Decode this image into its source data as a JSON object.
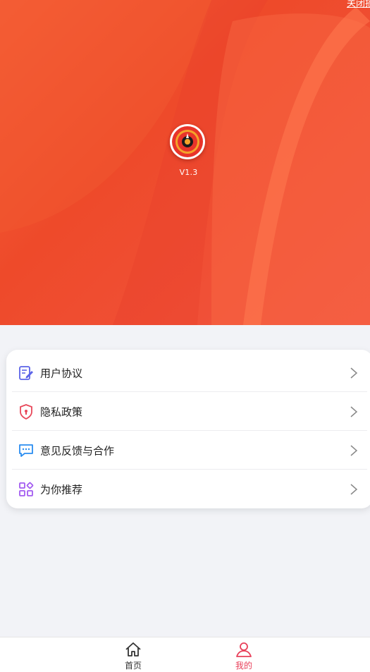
{
  "header": {
    "top_link": "关闭摇",
    "version": "V1.3",
    "app_icon": "speedometer-logo-icon",
    "gradient_colors": [
      "#f7643b",
      "#ee4a2a",
      "#f25541"
    ]
  },
  "menu": {
    "items": [
      {
        "label": "用户协议",
        "icon": "document-edit-icon",
        "color": "#5b63e8"
      },
      {
        "label": "隐私政策",
        "icon": "shield-icon",
        "color": "#e8485a"
      },
      {
        "label": "意见反馈与合作",
        "icon": "chat-bubble-icon",
        "color": "#2a8df0"
      },
      {
        "label": "为你推荐",
        "icon": "grid-apps-icon",
        "color": "#a35cf0"
      }
    ]
  },
  "tabbar": {
    "tabs": [
      {
        "label": "首页",
        "icon": "home-icon",
        "active": false
      },
      {
        "label": "我的",
        "icon": "user-icon",
        "active": true
      }
    ],
    "active_color": "#e8405a",
    "inactive_color": "#333333"
  }
}
